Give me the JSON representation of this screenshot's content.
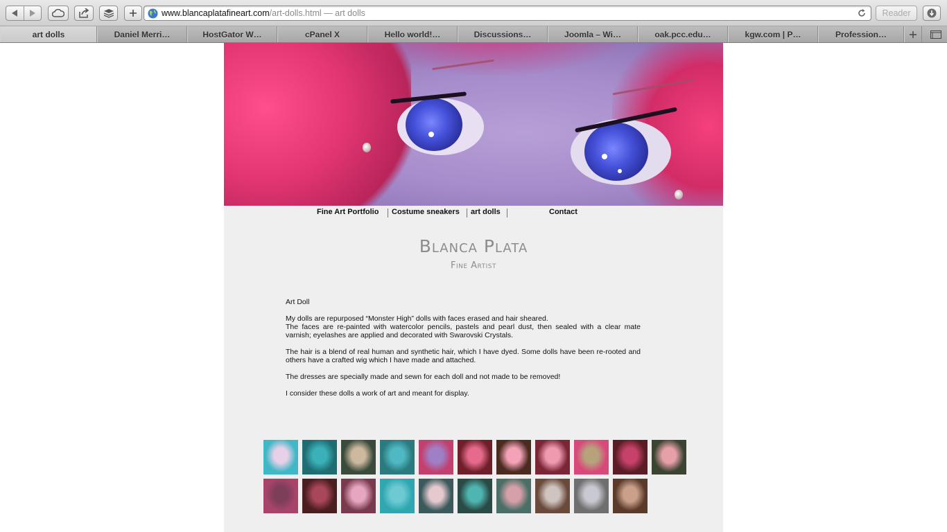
{
  "browser": {
    "url_host": "www.blancaplatafineart.com",
    "url_path": "/art-dolls.html",
    "url_title": " — art dolls",
    "reader_label": "Reader",
    "tabs": [
      {
        "label": "art dolls",
        "active": true
      },
      {
        "label": "Daniel Merri…",
        "active": false
      },
      {
        "label": "HostGator W…",
        "active": false
      },
      {
        "label": "cPanel X",
        "active": false
      },
      {
        "label": "Hello world!…",
        "active": false
      },
      {
        "label": "Discussions…",
        "active": false
      },
      {
        "label": "Joomla – Wi…",
        "active": false
      },
      {
        "label": "oak.pcc.edu…",
        "active": false
      },
      {
        "label": "kgw.com | P…",
        "active": false
      },
      {
        "label": "Profession…",
        "active": false
      }
    ]
  },
  "nav": {
    "items": [
      "Fine Art Portfolio",
      "Costume sneakers",
      "art dolls",
      "Contact"
    ]
  },
  "site": {
    "title": "Blanca Plata",
    "subtitle": "Fine Artist"
  },
  "content": {
    "heading": "Art Doll",
    "p1a": "My dolls are repurposed “Monster High” dolls with faces erased and hair sheared.",
    "p1b": "The faces are re-painted with watercolor pencils, pastels and pearl dust, then sealed with a clear mate varnish; eyelashes are applied and decorated with Swarovski Crystals.",
    "p2": "The hair is a blend of real human and synthetic hair, which I have dyed. Some dolls have been re-rooted and others have a crafted wig which I have made and attached.",
    "p3": "The dresses are specially made and sewn for each doll and not made to be removed!",
    "p4": "I consider these dolls a work of art and meant for display."
  },
  "gallery": {
    "row1": [
      {
        "bg": "#3fb7c4",
        "fg": "#e7d0e8"
      },
      {
        "bg": "#1f6d73",
        "fg": "#3ab1b8"
      },
      {
        "bg": "#3a4a3b",
        "fg": "#cdb9a0"
      },
      {
        "bg": "#2a7a7e",
        "fg": "#4fb8c2"
      },
      {
        "bg": "#c2406e",
        "fg": "#9f7fc6"
      },
      {
        "bg": "#6f1f2a",
        "fg": "#e66a8c"
      },
      {
        "bg": "#4b2a1f",
        "fg": "#f3a2b7"
      },
      {
        "bg": "#7a2636",
        "fg": "#f09ab0"
      },
      {
        "bg": "#d9487a",
        "fg": "#b6a37c"
      },
      {
        "bg": "#5a1d25",
        "fg": "#c7426a"
      },
      {
        "bg": "#3b4332",
        "fg": "#e6a0a8"
      }
    ],
    "row2": [
      {
        "bg": "#a8446a",
        "fg": "#7d3e5a"
      },
      {
        "bg": "#4a1d1f",
        "fg": "#a8465a"
      },
      {
        "bg": "#7a3a4e",
        "fg": "#e6a6c0"
      },
      {
        "bg": "#2fa6b0",
        "fg": "#6dcad3"
      },
      {
        "bg": "#3c5a5c",
        "fg": "#e6c9cf"
      },
      {
        "bg": "#2a4a45",
        "fg": "#4fb5b0"
      },
      {
        "bg": "#4b6e66",
        "fg": "#d6a0a8"
      },
      {
        "bg": "#6a4a3a",
        "fg": "#cfc4c0"
      },
      {
        "bg": "#6f6f6f",
        "fg": "#c9c9d2"
      },
      {
        "bg": "#5a3a2a",
        "fg": "#cba08a"
      }
    ]
  }
}
